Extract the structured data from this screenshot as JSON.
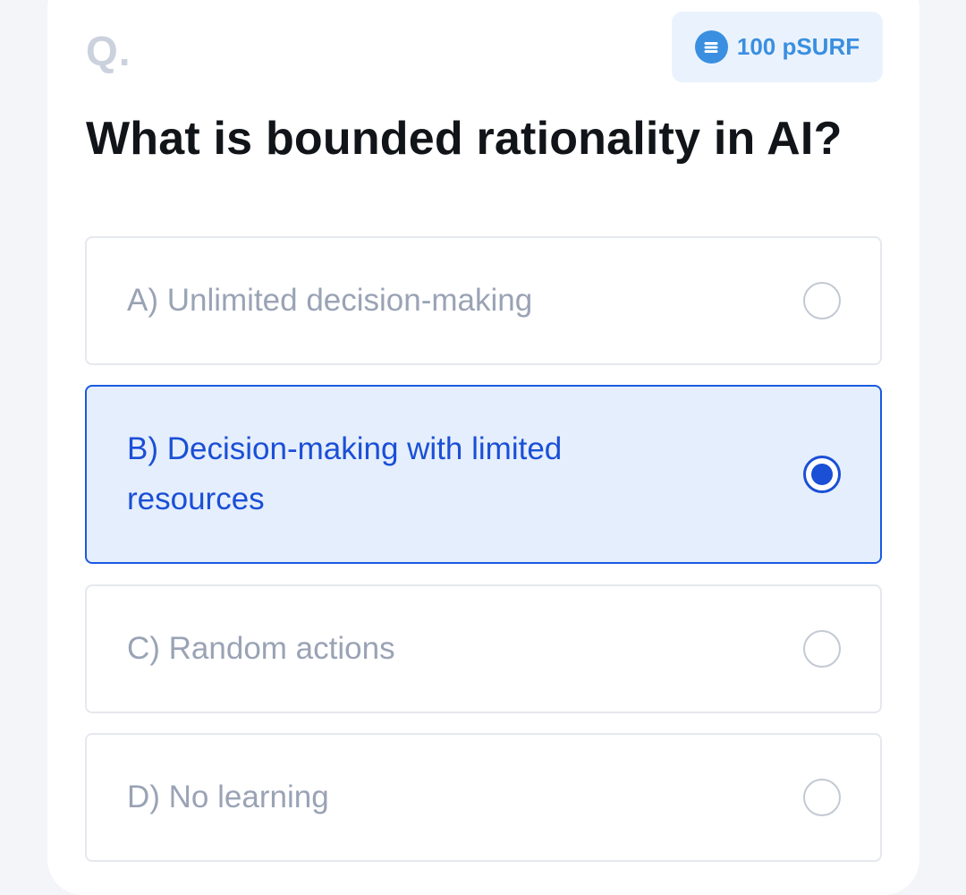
{
  "quiz": {
    "q_label": "Q.",
    "reward": {
      "icon": "surf-token-icon",
      "text": "100 pSURF",
      "color": "#3a8fe0"
    },
    "question": "What is bounded rationality in AI?",
    "options": [
      {
        "label": "A) Unlimited decision-making",
        "selected": false
      },
      {
        "label": "B) Decision-making with limited resources",
        "selected": true
      },
      {
        "label": "C) Random actions",
        "selected": false
      },
      {
        "label": "D) No learning",
        "selected": false
      }
    ],
    "accent_color": "#1a4fd6",
    "selected_bg": "#e5eefc"
  }
}
